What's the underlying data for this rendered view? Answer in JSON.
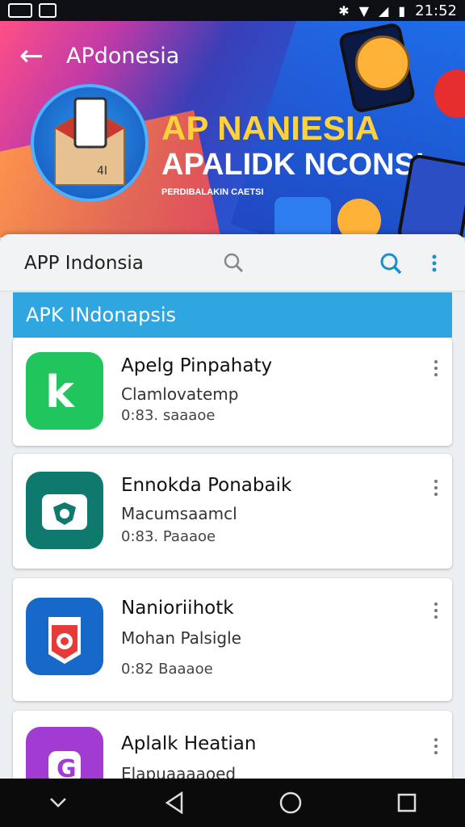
{
  "status_bar": {
    "time": "21:52"
  },
  "banner": {
    "back_icon": "arrow-left-icon",
    "title": "APdonesia",
    "headline_1": "AP NANIESIA",
    "headline_2": "APALIDK NCONS!",
    "headline_3": "PERDIBALAKIN CAETSI",
    "colors": {
      "yellow": "#ffd23c",
      "blue": "#1c73e8",
      "pink": "#ff4f87"
    }
  },
  "searchbar": {
    "title": "APP Indonsia",
    "search_icon": "search-icon",
    "menu_icon": "more-vert-icon"
  },
  "section": {
    "title": "APK INdonapsis",
    "color": "#2fa6e0"
  },
  "apps": [
    {
      "name": "Apelg Pinpahaty",
      "line2": "Clamlovatemp",
      "line3": "0:83. saaaoe",
      "icon_color": "#21c55d"
    },
    {
      "name": "Ennokda Ponabaik",
      "line2": "Macumsaamcl",
      "line3": "0:83. Paaaoe",
      "icon_color": "#0e7a6d"
    },
    {
      "name": "Nanioriihotk",
      "line2": "Mohan Palsigle",
      "line3": "0:82 Baaaoe",
      "icon_color": "#1769c9"
    },
    {
      "name": "Aplalk Heatian",
      "line2": "Elapuaaaaoed",
      "line3": "",
      "icon_color": "#a23bd1"
    }
  ],
  "navbar": {
    "icons": [
      "chevron-down-icon",
      "back-triangle-icon",
      "home-circle-icon",
      "recents-square-icon"
    ]
  }
}
